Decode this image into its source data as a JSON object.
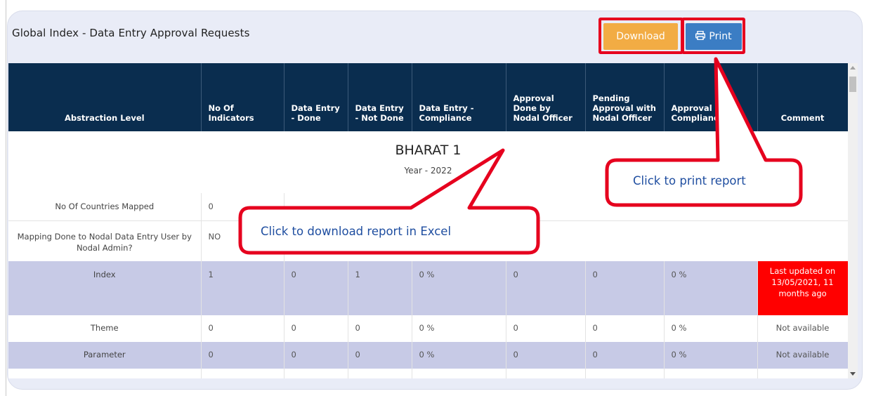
{
  "panel": {
    "title": "Global Index - Data Entry Approval Requests",
    "download_label": "Download",
    "print_label": "Print"
  },
  "table": {
    "headers": [
      "Abstraction Level",
      "No Of Indicators",
      "Data Entry - Done",
      "Data Entry - Not Done",
      "Data Entry - Compliance",
      "Approval Done by Nodal Officer",
      "Pending Approval with Nodal Officer",
      "Approval Compliance",
      "Comment"
    ],
    "country_name": "BHARAT 1",
    "year_label": "Year - 2022",
    "info_rows": [
      {
        "label": "No Of Countries Mapped",
        "value": "0"
      },
      {
        "label": "Mapping Done to Nodal Data Entry User by Nodal Admin?",
        "value": "NO"
      }
    ],
    "rows": [
      {
        "level": "Index",
        "indicators": "1",
        "done": "0",
        "not_done": "1",
        "compliance": "0 %",
        "approval_done": "0",
        "pending": "0",
        "approval_compliance": "0 %",
        "comment": "Last updated on 13/05/2021, 11 months ago",
        "comment_alert": true
      },
      {
        "level": "Theme",
        "indicators": "0",
        "done": "0",
        "not_done": "0",
        "compliance": "0 %",
        "approval_done": "0",
        "pending": "0",
        "approval_compliance": "0 %",
        "comment": "Not available",
        "comment_alert": false
      },
      {
        "level": "Parameter",
        "indicators": "0",
        "done": "0",
        "not_done": "0",
        "compliance": "0 %",
        "approval_done": "0",
        "pending": "0",
        "approval_compliance": "0 %",
        "comment": "Not available",
        "comment_alert": false
      }
    ]
  },
  "callouts": {
    "download": "Click to download  report in Excel",
    "print": "Click to print  report"
  },
  "colors": {
    "header_bg": "#0a2d4f",
    "row_alt": "#c7cae6",
    "download_btn": "#f2ac44",
    "print_btn": "#3b7dc4",
    "alert": "#ff0000",
    "highlight": "#e6001e",
    "callout_text": "#1f4ea0"
  }
}
